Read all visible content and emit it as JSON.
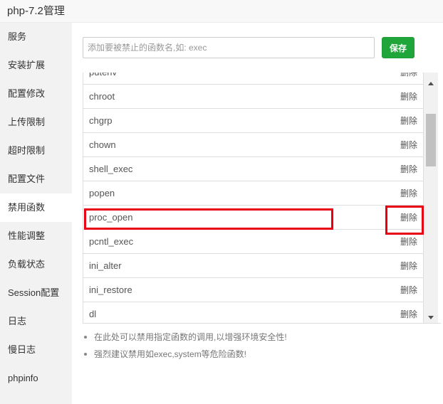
{
  "window": {
    "title": "php-7.2管理"
  },
  "sidebar": {
    "items": [
      {
        "label": "服务"
      },
      {
        "label": "安装扩展"
      },
      {
        "label": "配置修改"
      },
      {
        "label": "上传限制"
      },
      {
        "label": "超时限制"
      },
      {
        "label": "配置文件"
      },
      {
        "label": "禁用函数",
        "active": true
      },
      {
        "label": "性能调整"
      },
      {
        "label": "负载状态"
      },
      {
        "label": "Session配置"
      },
      {
        "label": "日志"
      },
      {
        "label": "慢日志"
      },
      {
        "label": "phpinfo"
      }
    ]
  },
  "add_form": {
    "placeholder": "添加要被禁止的函数名,如: exec",
    "value": "",
    "save_label": "保存",
    "save_color": "#20a53a"
  },
  "functions": {
    "delete_label": "删除",
    "rows": [
      {
        "name": "putenv"
      },
      {
        "name": "chroot"
      },
      {
        "name": "chgrp"
      },
      {
        "name": "chown"
      },
      {
        "name": "shell_exec"
      },
      {
        "name": "popen"
      },
      {
        "name": "proc_open",
        "highlighted": true
      },
      {
        "name": "pcntl_exec"
      },
      {
        "name": "ini_alter"
      },
      {
        "name": "ini_restore"
      },
      {
        "name": "dl"
      }
    ]
  },
  "highlight_color": "#e60012",
  "tips": [
    {
      "text": "在此处可以禁用指定函数的调用,以增强环境安全性!"
    },
    {
      "text": "强烈建议禁用如exec,system等危险函数!"
    }
  ]
}
